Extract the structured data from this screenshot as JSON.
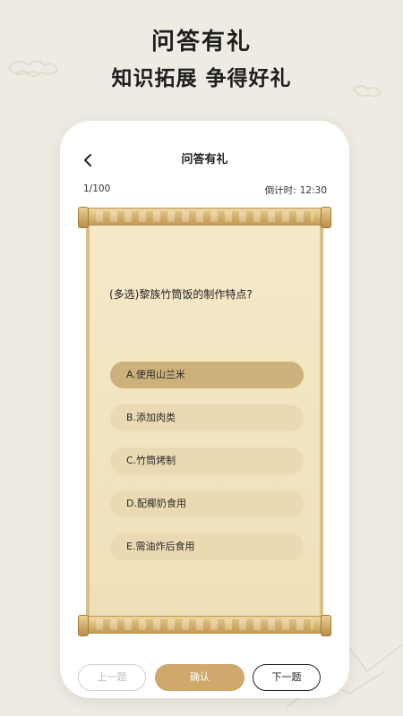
{
  "promo": {
    "title": "问答有礼",
    "subtitle": "知识拓展 争得好礼"
  },
  "nav": {
    "title": "问答有礼"
  },
  "progress": {
    "counter": "1/100",
    "timer_label": "倒计时:",
    "timer_value": "12:30"
  },
  "quiz": {
    "question": "(多选)黎族竹筒饭的制作特点?",
    "options": [
      {
        "label": "A.使用山兰米",
        "selected": true
      },
      {
        "label": "B.添加肉类",
        "selected": false
      },
      {
        "label": "C.竹筒烤制",
        "selected": false
      },
      {
        "label": "D.配椰奶食用",
        "selected": false
      },
      {
        "label": "E.需油炸后食用",
        "selected": false
      }
    ]
  },
  "actions": {
    "prev": "上一题",
    "confirm": "确认",
    "next": "下一题"
  },
  "colors": {
    "accent": "#cfa96b",
    "selected_option": "#cdb17a",
    "option": "#ead9b1",
    "paper": "#f3e6c3"
  }
}
